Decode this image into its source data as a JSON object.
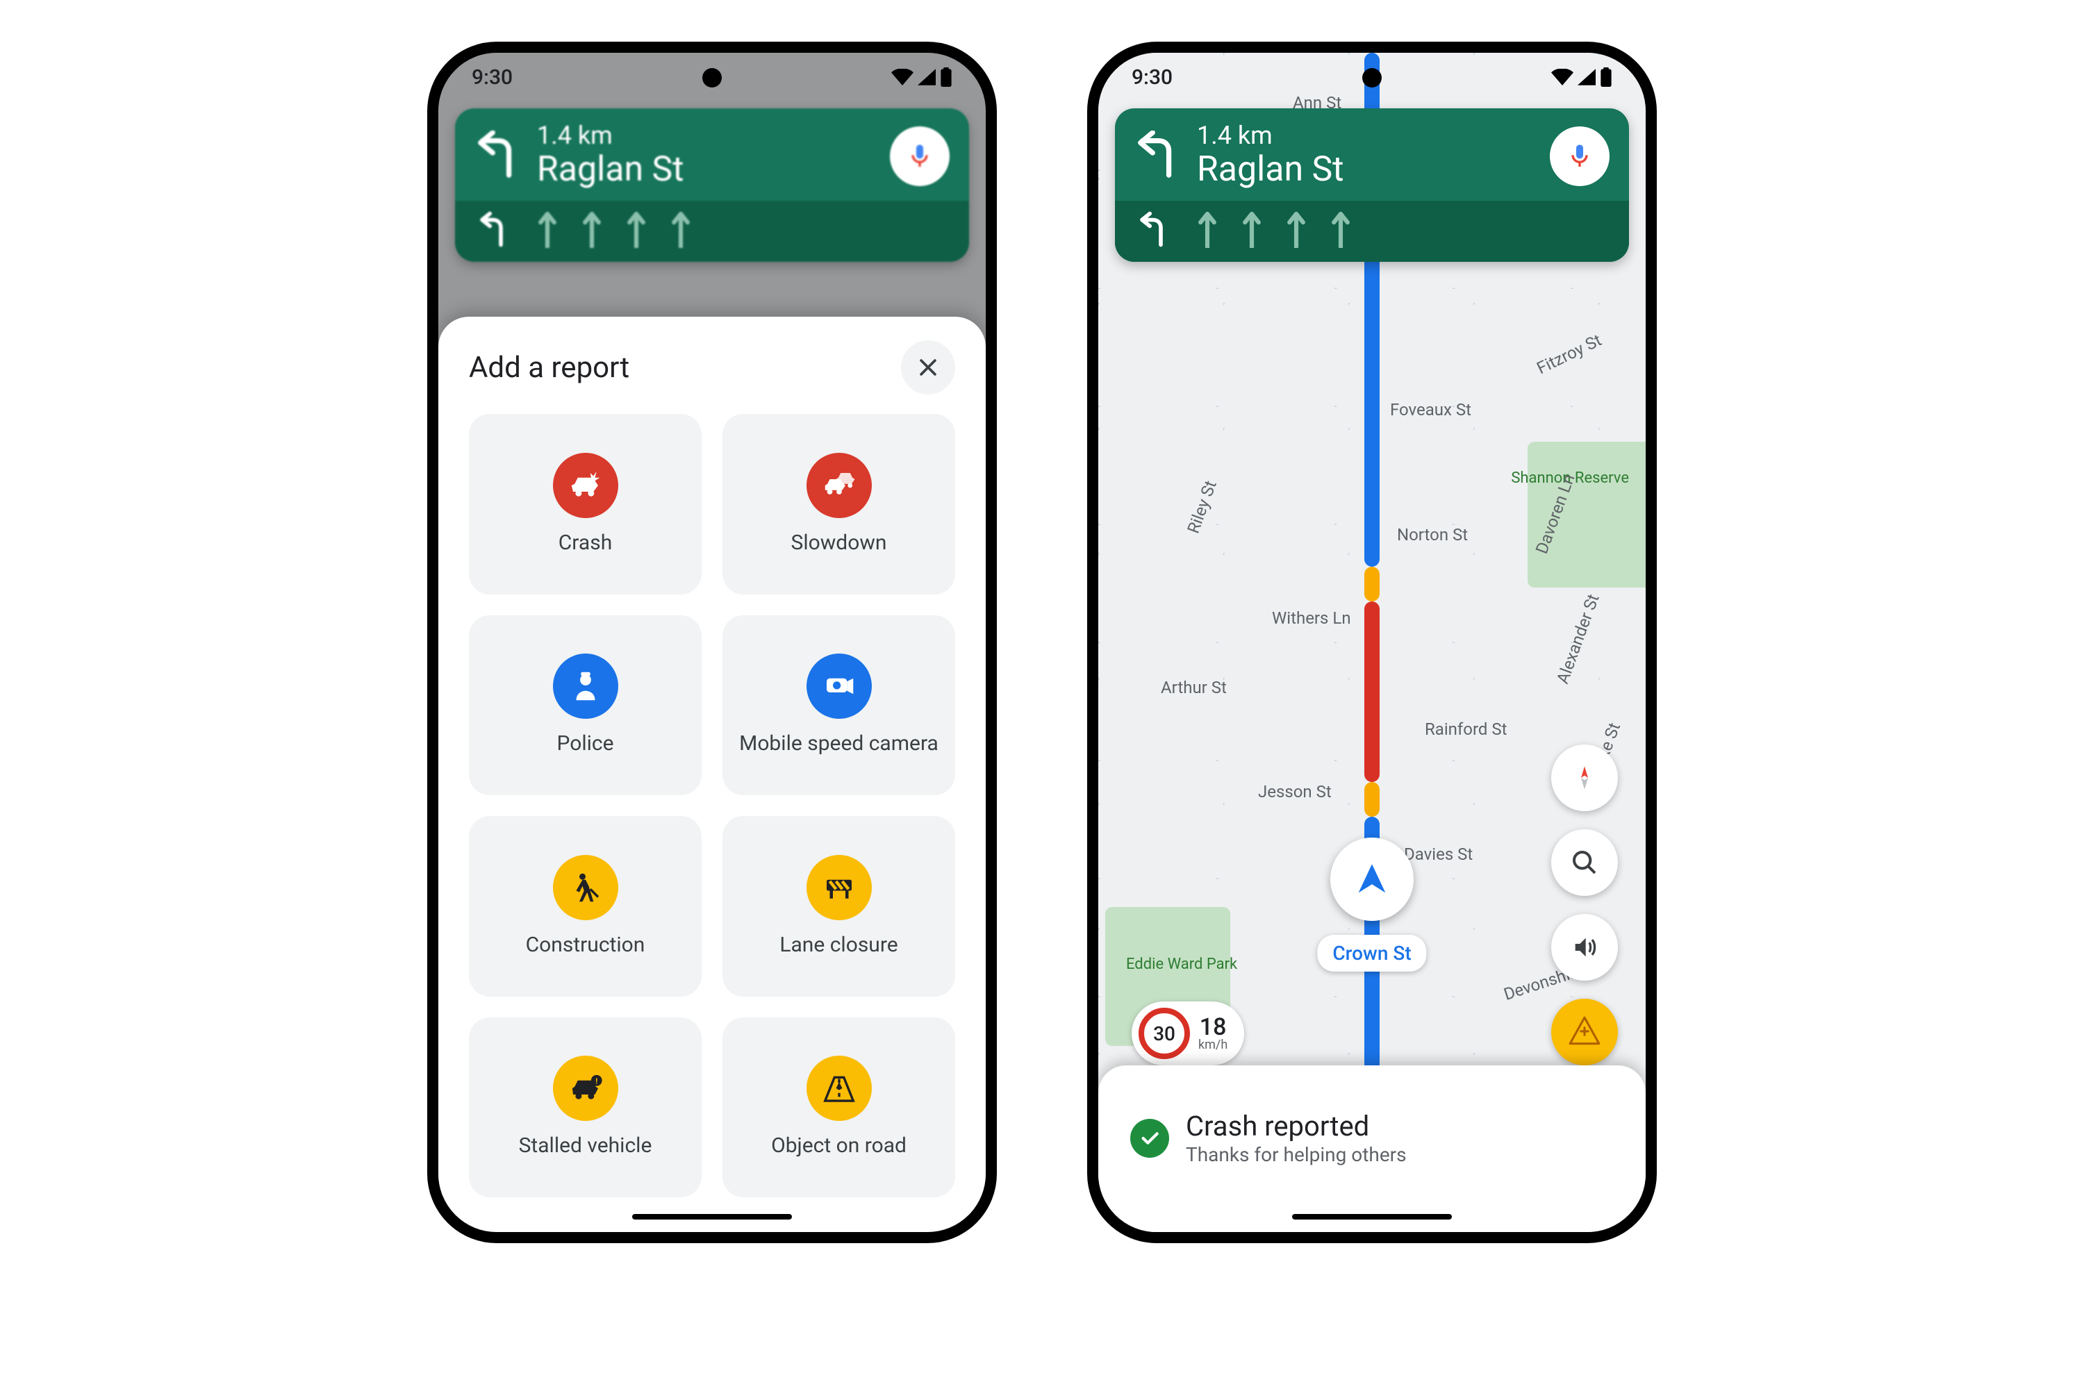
{
  "status": {
    "time": "9:30"
  },
  "nav": {
    "distance": "1.4 km",
    "street": "Raglan St"
  },
  "report_sheet": {
    "title": "Add a report",
    "items": [
      {
        "id": "crash",
        "label": "Crash",
        "color": "red"
      },
      {
        "id": "slowdown",
        "label": "Slowdown",
        "color": "red"
      },
      {
        "id": "police",
        "label": "Police",
        "color": "blue"
      },
      {
        "id": "speed-camera",
        "label": "Mobile speed camera",
        "color": "blue"
      },
      {
        "id": "construction",
        "label": "Construction",
        "color": "yellow"
      },
      {
        "id": "lane-closure",
        "label": "Lane closure",
        "color": "yellow"
      },
      {
        "id": "stalled-vehicle",
        "label": "Stalled vehicle",
        "color": "yellow"
      },
      {
        "id": "object-on-road",
        "label": "Object on road",
        "color": "yellow"
      }
    ]
  },
  "map": {
    "current_street": "Crown St",
    "speed_limit": "30",
    "current_speed": "18",
    "speed_unit": "km/h",
    "labels": {
      "ann": "Ann St",
      "fitzroy": "Fitzroy St",
      "foveaux": "Foveaux St",
      "riley": "Riley St",
      "norton": "Norton St",
      "withers": "Withers Ln",
      "arthur": "Arthur St",
      "rainford": "Rainford St",
      "jesson": "Jesson St",
      "davies": "Davies St",
      "devonshire": "Devonshire St",
      "davoren": "Davoren Ln",
      "alexander": "Alexander St",
      "bourke": "Bourke St",
      "shannon": "Shannon Reserve",
      "eddie": "Eddie Ward Park"
    }
  },
  "toast": {
    "title": "Crash reported",
    "subtitle": "Thanks for helping others"
  }
}
